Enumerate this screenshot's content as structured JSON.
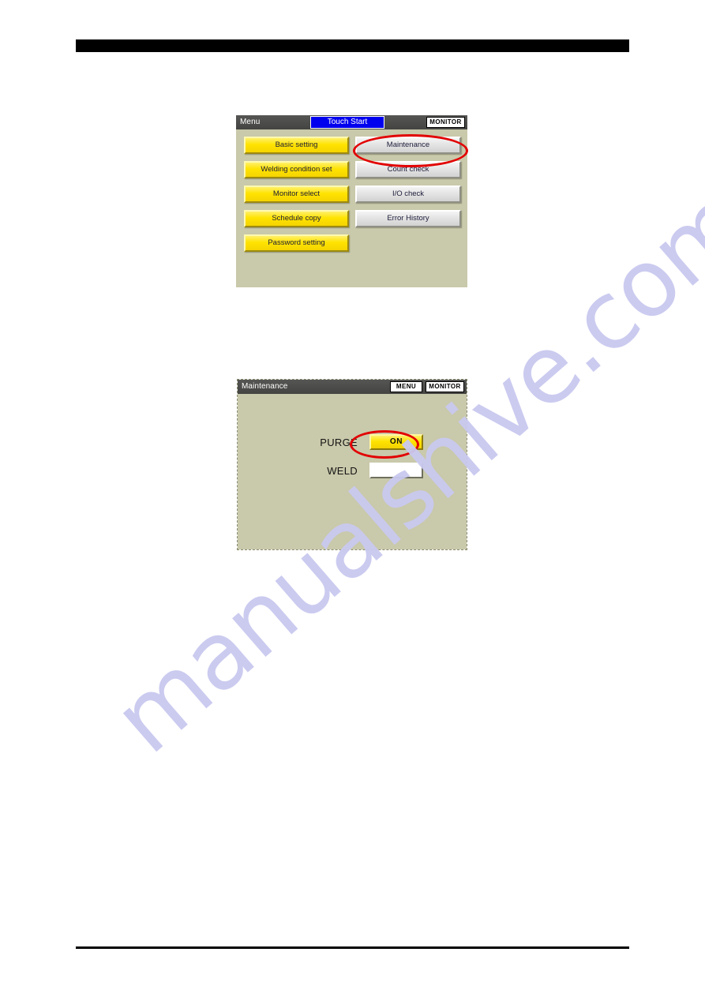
{
  "page": {
    "header_rule": "",
    "footer_rule": "",
    "watermark": "manualshive.com"
  },
  "screens": [
    {
      "id": "menu-screen",
      "titlebar": {
        "title": "Menu",
        "touch_start_label": "Touch Start",
        "monitor_label": "MONITOR"
      },
      "left_buttons": [
        {
          "label": "Basic setting"
        },
        {
          "label": "Welding condition set"
        },
        {
          "label": "Monitor select"
        },
        {
          "label": "Schedule copy"
        },
        {
          "label": "Password setting"
        }
      ],
      "right_buttons": [
        {
          "label": "Maintenance"
        },
        {
          "label": "Count check"
        },
        {
          "label": "I/O check"
        },
        {
          "label": "Error History"
        }
      ],
      "highlight": "Maintenance"
    },
    {
      "id": "maintenance-screen",
      "titlebar": {
        "title": "Maintenance",
        "menu_label": "MENU",
        "monitor_label": "MONITOR"
      },
      "rows": [
        {
          "label": "PURGE",
          "value": "ON"
        },
        {
          "label": "WELD",
          "value": ""
        }
      ],
      "highlight": "ON"
    }
  ],
  "colors": {
    "screen_background": "#c9c9ab",
    "titlebar": "#4d4d4d",
    "button_yellow": "#ffe600",
    "button_gray": "#e2e2e2",
    "touch_start_blue": "#0000ee",
    "annotation_red": "#e20000",
    "watermark": "#c9c9f0",
    "rule_black": "#000000"
  }
}
